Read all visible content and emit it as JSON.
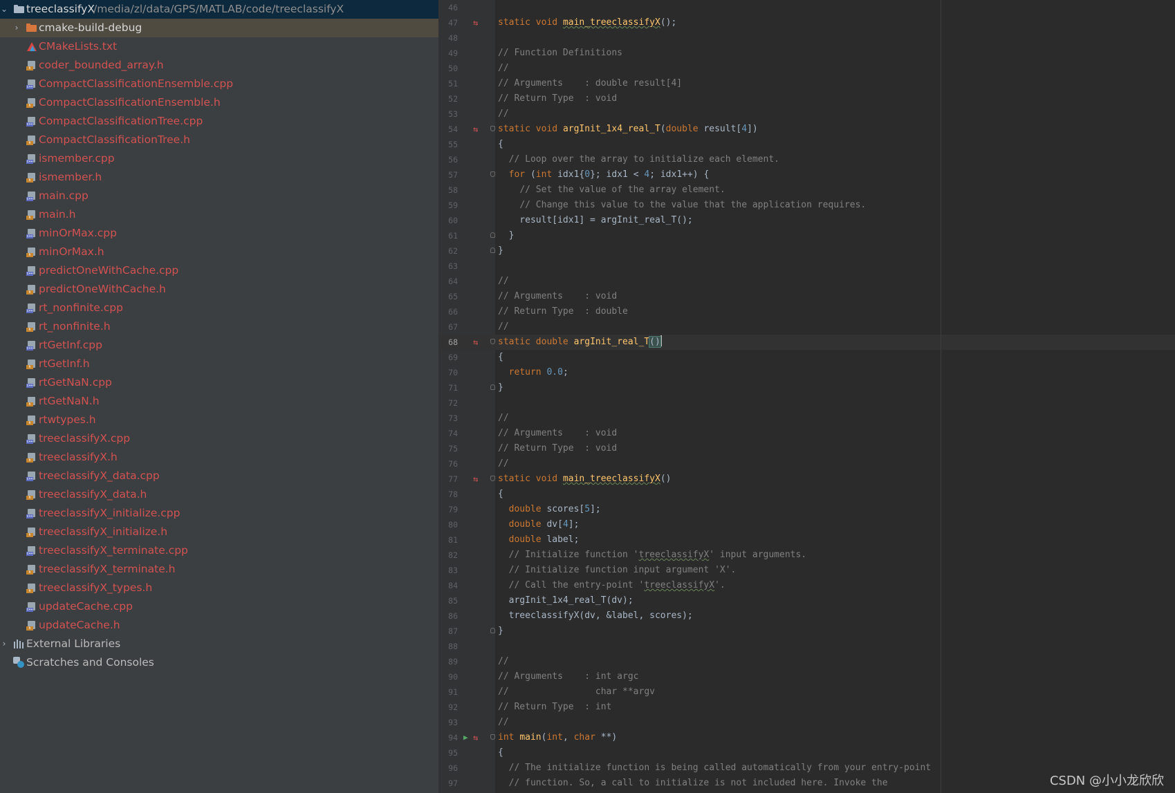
{
  "project": {
    "root_name": "treeclassifyX",
    "root_path": "/media/zl/data/GPS/MATLAB/code/treeclassifyX",
    "build_dir": "cmake-build-debug",
    "files": [
      {
        "name": "CMakeLists.txt",
        "kind": "cmake"
      },
      {
        "name": "coder_bounded_array.h",
        "kind": "h"
      },
      {
        "name": "CompactClassificationEnsemble.cpp",
        "kind": "cpp"
      },
      {
        "name": "CompactClassificationEnsemble.h",
        "kind": "h"
      },
      {
        "name": "CompactClassificationTree.cpp",
        "kind": "cpp"
      },
      {
        "name": "CompactClassificationTree.h",
        "kind": "h"
      },
      {
        "name": "ismember.cpp",
        "kind": "cpp"
      },
      {
        "name": "ismember.h",
        "kind": "h"
      },
      {
        "name": "main.cpp",
        "kind": "cpp"
      },
      {
        "name": "main.h",
        "kind": "h"
      },
      {
        "name": "minOrMax.cpp",
        "kind": "cpp"
      },
      {
        "name": "minOrMax.h",
        "kind": "h"
      },
      {
        "name": "predictOneWithCache.cpp",
        "kind": "cpp"
      },
      {
        "name": "predictOneWithCache.h",
        "kind": "h"
      },
      {
        "name": "rt_nonfinite.cpp",
        "kind": "cpp"
      },
      {
        "name": "rt_nonfinite.h",
        "kind": "h"
      },
      {
        "name": "rtGetInf.cpp",
        "kind": "cpp"
      },
      {
        "name": "rtGetInf.h",
        "kind": "h"
      },
      {
        "name": "rtGetNaN.cpp",
        "kind": "cpp"
      },
      {
        "name": "rtGetNaN.h",
        "kind": "h"
      },
      {
        "name": "rtwtypes.h",
        "kind": "h"
      },
      {
        "name": "treeclassifyX.cpp",
        "kind": "cpp"
      },
      {
        "name": "treeclassifyX.h",
        "kind": "h"
      },
      {
        "name": "treeclassifyX_data.cpp",
        "kind": "cpp"
      },
      {
        "name": "treeclassifyX_data.h",
        "kind": "h"
      },
      {
        "name": "treeclassifyX_initialize.cpp",
        "kind": "cpp"
      },
      {
        "name": "treeclassifyX_initialize.h",
        "kind": "h"
      },
      {
        "name": "treeclassifyX_terminate.cpp",
        "kind": "cpp"
      },
      {
        "name": "treeclassifyX_terminate.h",
        "kind": "h"
      },
      {
        "name": "treeclassifyX_types.h",
        "kind": "h"
      },
      {
        "name": "updateCache.cpp",
        "kind": "cpp"
      },
      {
        "name": "updateCache.h",
        "kind": "h"
      }
    ],
    "external_libraries": "External Libraries",
    "scratches": "Scratches and Consoles"
  },
  "editor": {
    "current_line": 68,
    "lines": [
      {
        "n": 46,
        "t": ""
      },
      {
        "n": 47,
        "t": "static void main_treeclassifyX();",
        "mark": "impl"
      },
      {
        "n": 48,
        "t": ""
      },
      {
        "n": 49,
        "t": "// Function Definitions"
      },
      {
        "n": 50,
        "t": "//"
      },
      {
        "n": 51,
        "t": "// Arguments    : double result[4]"
      },
      {
        "n": 52,
        "t": "// Return Type  : void"
      },
      {
        "n": 53,
        "t": "//"
      },
      {
        "n": 54,
        "t": "static void argInit_1x4_real_T(double result[4])",
        "mark": "impl",
        "fold": "start"
      },
      {
        "n": 55,
        "t": "{"
      },
      {
        "n": 56,
        "t": "  // Loop over the array to initialize each element."
      },
      {
        "n": 57,
        "t": "  for (int idx1{0}; idx1 < 4; idx1++) {",
        "fold": "start"
      },
      {
        "n": 58,
        "t": "    // Set the value of the array element."
      },
      {
        "n": 59,
        "t": "    // Change this value to the value that the application requires."
      },
      {
        "n": 60,
        "t": "    result[idx1] = argInit_real_T();"
      },
      {
        "n": 61,
        "t": "  }",
        "fold": "end"
      },
      {
        "n": 62,
        "t": "}",
        "fold": "end"
      },
      {
        "n": 63,
        "t": ""
      },
      {
        "n": 64,
        "t": "//"
      },
      {
        "n": 65,
        "t": "// Arguments    : void"
      },
      {
        "n": 66,
        "t": "// Return Type  : double"
      },
      {
        "n": 67,
        "t": "//"
      },
      {
        "n": 68,
        "t": "static double argInit_real_T()",
        "mark": "impl",
        "fold": "start"
      },
      {
        "n": 69,
        "t": "{"
      },
      {
        "n": 70,
        "t": "  return 0.0;"
      },
      {
        "n": 71,
        "t": "}",
        "fold": "end"
      },
      {
        "n": 72,
        "t": ""
      },
      {
        "n": 73,
        "t": "//"
      },
      {
        "n": 74,
        "t": "// Arguments    : void"
      },
      {
        "n": 75,
        "t": "// Return Type  : void"
      },
      {
        "n": 76,
        "t": "//"
      },
      {
        "n": 77,
        "t": "static void main_treeclassifyX()",
        "mark": "impl",
        "fold": "start"
      },
      {
        "n": 78,
        "t": "{"
      },
      {
        "n": 79,
        "t": "  double scores[5];"
      },
      {
        "n": 80,
        "t": "  double dv[4];"
      },
      {
        "n": 81,
        "t": "  double label;"
      },
      {
        "n": 82,
        "t": "  // Initialize function 'treeclassifyX' input arguments."
      },
      {
        "n": 83,
        "t": "  // Initialize function input argument 'X'."
      },
      {
        "n": 84,
        "t": "  // Call the entry-point 'treeclassifyX'."
      },
      {
        "n": 85,
        "t": "  argInit_1x4_real_T(dv);"
      },
      {
        "n": 86,
        "t": "  treeclassifyX(dv, &label, scores);"
      },
      {
        "n": 87,
        "t": "}",
        "fold": "end"
      },
      {
        "n": 88,
        "t": ""
      },
      {
        "n": 89,
        "t": "//"
      },
      {
        "n": 90,
        "t": "// Arguments    : int argc"
      },
      {
        "n": 91,
        "t": "//                char **argv"
      },
      {
        "n": 92,
        "t": "// Return Type  : int"
      },
      {
        "n": 93,
        "t": "//"
      },
      {
        "n": 94,
        "t": "int main(int, char **)",
        "mark": "run",
        "fold": "start"
      },
      {
        "n": 95,
        "t": "{"
      },
      {
        "n": 96,
        "t": "  // The initialize function is being called automatically from your entry-point"
      },
      {
        "n": 97,
        "t": "  // function. So, a call to initialize is not included here. Invoke the"
      }
    ]
  },
  "watermark": "CSDN @小小龙欣欣",
  "colors": {
    "keyword": "#cc7832",
    "comment": "#808080",
    "function": "#ffc66d",
    "number": "#6897bb",
    "text": "#a9b7c6",
    "file_error_red": "#d25252"
  }
}
